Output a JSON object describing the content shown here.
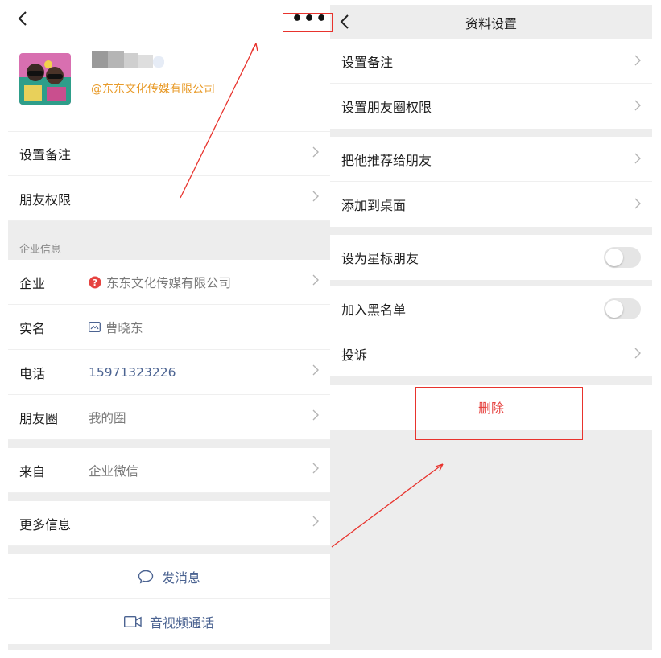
{
  "left": {
    "back_icon": "chevron-left-icon",
    "more_icon": "more-dots-icon",
    "more_label": "•••",
    "profile": {
      "company_tag": "@东东文化传媒有限公司"
    },
    "rows_top": [
      {
        "label": "设置备注"
      },
      {
        "label": "朋友权限"
      }
    ],
    "section_title": "企业信息",
    "info_rows": [
      {
        "label": "企业",
        "value": "东东文化传媒有限公司",
        "icon": "question-badge-icon",
        "chevron": true
      },
      {
        "label": "实名",
        "value": "曹晓东",
        "icon": "id-card-icon",
        "chevron": false
      },
      {
        "label": "电话",
        "value": "15971323226",
        "chevron": true
      },
      {
        "label": "朋友圈",
        "value": "我的圈",
        "chevron": true
      }
    ],
    "source_row": {
      "label": "来自",
      "value": "企业微信"
    },
    "more_info_row": {
      "label": "更多信息"
    },
    "actions": {
      "message": "发消息",
      "call": "音视频通话"
    }
  },
  "right": {
    "back_icon": "chevron-left-icon",
    "title": "资料设置",
    "group1": [
      {
        "label": "设置备注"
      },
      {
        "label": "设置朋友圈权限"
      }
    ],
    "group2": [
      {
        "label": "把他推荐给朋友"
      },
      {
        "label": "添加到桌面"
      }
    ],
    "star_friend": {
      "label": "设为星标朋友",
      "on": false
    },
    "group4": {
      "blacklist": {
        "label": "加入黑名单",
        "on": false
      },
      "report": {
        "label": "投诉"
      }
    },
    "delete_label": "删除"
  },
  "colors": {
    "accent_link": "#4b6391",
    "company_tag": "#e89b2a",
    "delete": "#e64340",
    "annotation": "#e8332d",
    "background_gray": "#ededed"
  }
}
